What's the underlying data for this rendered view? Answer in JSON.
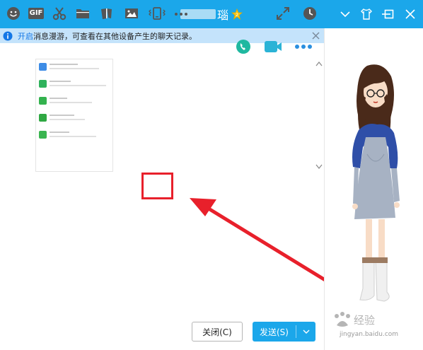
{
  "window": {
    "title": "瑙",
    "badge_icon": "star-crown-badge-icon",
    "controls": [
      "chevron-down-icon",
      "skin-shirt-icon",
      "minimize-icon",
      "maximize-icon",
      "close-icon"
    ]
  },
  "notice": {
    "link_text": "开启",
    "text": "消息漫游，可查看在其他设备产生的聊天记录。",
    "info_icon": "info-icon",
    "close_icon": "close-icon"
  },
  "message_area": {
    "call_icons": [
      "phone-call-icon",
      "video-call-icon",
      "more-apps-icon"
    ],
    "screenshot_items": [
      {
        "icon": "news-app-icon",
        "color": "#3d8ce6"
      },
      {
        "icon": "browser-app-icon",
        "color": "#2fb25c"
      },
      {
        "icon": "wechat-pay-icon",
        "color": "#33b24e"
      },
      {
        "icon": "security-center-icon",
        "color": "#2fa843"
      },
      {
        "icon": "wechat-team-icon",
        "color": "#3ab550"
      }
    ]
  },
  "toolbar": {
    "items": [
      "emoji-icon",
      "gif-icon",
      "scissors-icon",
      "folder-icon",
      "stickers-icon",
      "image-icon",
      "shake-window-icon",
      "more-dots-icon"
    ],
    "gif_label": "GIF",
    "expand_icon": "expand-icon",
    "history_icon": "clock-history-icon",
    "highlight_color": "#e8202b"
  },
  "buttons": {
    "close_label": "关闭(C)",
    "send_label": "发送(S)"
  },
  "watermark": {
    "text": "jingyan.baidu.com"
  },
  "colors": {
    "accent": "#1ba7ea",
    "notice_bg": "#c4e3fb",
    "arrow": "#e8202b"
  }
}
